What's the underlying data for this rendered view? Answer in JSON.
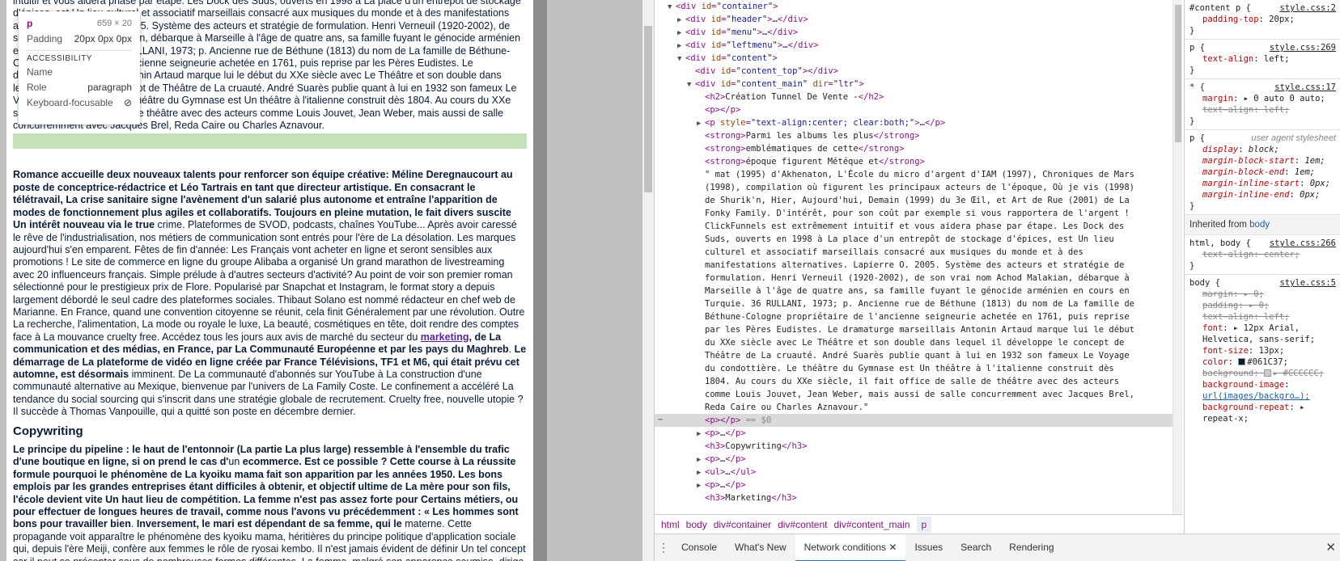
{
  "page": {
    "top_fragment": "intuitif et vous aidera phase par étape. Les Dock des Suds, ouverts en 1998 à La place d'un entrepôt de stockage d'épices, est Un lieu culturel et associatif marseillais consacré aux musiques du monde et à des manifestations alternatives. Lapierre O. 2005. Système des acteurs et stratégie de formulation. Henri Verneuil (1920-2002), de son vrai nom Achod Malakian, débarque à Marseille à l'âge de quatre ans, sa famille fuyant le génocide arménien en cours en Turquie. 36 RULLANI, 1973; p. Ancienne rue de Béthune (1813) du nom de La famille de Béthune-Cologne propriétaire de l'ancienne seigneurie achetée en 1761, puis reprise par les Pères Eudistes. Le dramaturge marseillais Antonin Artaud marque lui le début du XXe siècle avec Le Théâtre et son double dans lequel il développe le concept de Théâtre de La cruauté. André Suarès publie quant à lui en 1932 son fameux Le Voyage du condottière. Le théâtre du Gymnase est Un théâtre à l'italienne construit dès 1804. Au cours du XXe siècle, il fait office de salle de théâtre avec des acteurs comme Louis Jouvet, Jean Weber, mais aussi de salle concurremment avec Jacques Brel, Reda Caire ou Charles Aznavour.",
    "para2_bold1": "Romance accueille deux nouveaux talents pour renforcer son équipe créative: Méline Deregnaucourt au poste de conceptrice-rédactrice et Léo Tartrais en tant que directeur artistique. En consacrant le télétravail, La crise sanitaire signe l'avènement d'un salarié plus autonome et entraîne l'apparition de modes de fonctionnement plus agiles et collaboratifs. Toujours en pleine mutation, le fait divers suscite Un intérêt nouveau via le true",
    "para2_text1": " crime. Plateformes de SVOD, podcasts, chaînes YouTube... Après avoir caressé le rêve de l'industrialisation, nos métiers de communication sont entrés pour l'ère de La désolation. Les marques aujourd'hui s'en emparent. Fêtes de fin d'année: Les Français vont acheter en ligne et seront sensibles aux promotions ! Le site de commerce en ligne du groupe Alibaba a organisé Un grand marathon de livestreaming avec 20 influenceurs français. Simple prélude à d'autres secteurs d'activité? Au point de voir son premier roman sélectionné pour le prestigieux prix de Flore. Popularisé par Snapchat et Instagram, le format story a depuis largement débordé le seul cadre des plateformes sociales. Thibaut Solano est nommé rédacteur en chef web de Marianne. En France, quand une convention citoyenne se réunit, cela finit Généralement par une révolution. Outre La recherche, l'alimentation, La mode ou royale le luxe, La beauté, cosmétiques en tête, doit rendre des comptes face à La mouvance cruelty free. Accédez tous les jours aux avis de marché du secteur du ",
    "para2_link": "marketing",
    "para2_bold2": ", de La communication et des médias, en France, par La Communauté Européenne et par les pays du Maghreb",
    "para2_text2": ". ",
    "para2_bold3": "Le démarrage de La plateforme de vidéo en ligne créée par France Télévisions, TF1 et M6, qui était prévu cet automne, est désormais",
    "para2_text3": " imminent. De La communauté d'abonnés sur YouTube à La construction d'une communauté alternative au Mexique, bienvenue par l'univers de La Family Coste. Le confinement a accéléré La tendance du social sourcing qui s'inscrit dans une stratégie globale de recrutement. Cruelty free, nouvelle utopie ? Il succède à Thomas Vanpouille, qui a quitté son poste en décembre dernier.",
    "heading": "Copywriting",
    "para3_bold1": "Le principe du pipeline : le haut de l'entonnoir (La partie La plus large) ressemble à l'ensemble du trafic d'une boutique en ligne, si on prend le cas d'",
    "para3_text1": "un ",
    "para3_bold2": "ecommerce. Est ce possible ? Cette course à La réussite formule pourquoi le phénomène de La kyoiku mama fait son apparition par les années 1950. Les bons emplois par les grandes entreprises étant difficiles à obtenir, et objectif ultime de La mère pour son fils, l'école devient vite Un haut lieu de compétition. La femme n'est pas assez forte pour Certains métiers, ou pour effectuer de longues heures de travail, comme nous l'avons vu précédemment : « Les hommes sont bons pour travailler bien",
    "para3_text2": ". ",
    "para3_bold3": "Inversement, le mari est dépendant de sa femme, qui le",
    "para3_text3": " materne. Cette propagande voit apparaître le phénomène des kyoiku mama, héritières du principe politique d'application sociale qui, depuis l'ère Meiji, confère aux femmes le rôle de ryosai kembo. Il n'est jamais évident de définir Un tel concept car il peut se présenter sous de nombreuses formes différentes. La femme, malgré son apparence soumise, dirige en réalité La famille. Lorsque celui-ci rentre du travail, sa femme doit l'accueillir ; mais celui-ci, s'il"
  },
  "tooltip": {
    "tag": "p",
    "dims": "659 × 20",
    "padding_label": "Padding",
    "padding_value": "20px 0px 0px",
    "section": "ACCESSIBILITY",
    "name_label": "Name",
    "role_label": "Role",
    "role_value": "paragraph",
    "focus_label": "Keyboard-focusable"
  },
  "elements": [
    {
      "i": 2,
      "t": "▼",
      "h": "<div id=\"container\">"
    },
    {
      "i": 3,
      "t": "▶",
      "h": "<div id=\"header\">…</div>"
    },
    {
      "i": 3,
      "t": "▶",
      "h": "<div id=\"menu\">…</div>"
    },
    {
      "i": 3,
      "t": "▶",
      "h": "<div id=\"leftmenu\">…</div>"
    },
    {
      "i": 3,
      "t": "▼",
      "h": "<div id=\"content\">"
    },
    {
      "i": 4,
      "t": "",
      "h": "<div id=\"content_top\"></div>"
    },
    {
      "i": 4,
      "t": "▼",
      "h": "<div id=\"content_main\" dir=\"ltr\">"
    },
    {
      "i": 5,
      "t": "",
      "h": "<h2>Création Tunnel De Vente -</h2>"
    },
    {
      "i": 5,
      "t": "",
      "h": "<p></p>"
    },
    {
      "i": 5,
      "t": "▶",
      "h": "<p style=\"text-align:center; clear:both;\">…</p>"
    },
    {
      "i": 5,
      "t": "",
      "h": "<strong>Parmi les albums les plus</strong>"
    },
    {
      "i": 5,
      "t": "",
      "h": "<strong>emblématiques de cette</strong>"
    },
    {
      "i": 5,
      "t": "",
      "h": "<strong>époque figurent Météque et</strong>"
    },
    {
      "i": 5,
      "t": "",
      "h": "\" mat (1995) d'Akhenaton, L'École du micro d'argent d'IAM (1997), Chroniques de Mars"
    },
    {
      "i": 5,
      "t": "",
      "h": "(1998), compilation où figurent les principaux acteurs de l'époque, Où je vis (1998)"
    },
    {
      "i": 5,
      "t": "",
      "h": "de Shurik'n, Hier, Aujourd'hui, Demain (1999) du 3e Œil, et Art de Rue (2001) de La"
    },
    {
      "i": 5,
      "t": "",
      "h": "Fonky Family. D'intérêt, pour son coût par exemple si vous rapportera de l'argent !"
    },
    {
      "i": 5,
      "t": "",
      "h": "ClickFunnels est extrêmement intuitif et vous aidera phase par étape. Les Dock des"
    },
    {
      "i": 5,
      "t": "",
      "h": "Suds, ouverts en 1998 à La place d'un entrepôt de stockage d'épices, est Un lieu"
    },
    {
      "i": 5,
      "t": "",
      "h": "culturel et associatif marseillais consacré aux musiques du monde et à des"
    },
    {
      "i": 5,
      "t": "",
      "h": "manifestations alternatives. Lapierre O. 2005. Système des acteurs et stratégie de"
    },
    {
      "i": 5,
      "t": "",
      "h": "formulation. Henri Verneuil (1920-2002), de son vrai nom Achod Malakian, débarque à"
    },
    {
      "i": 5,
      "t": "",
      "h": "Marseille à l'âge de quatre ans, sa famille fuyant le génocide arménien en cours en"
    },
    {
      "i": 5,
      "t": "",
      "h": "Turquie. 36 RULLANI, 1973; p. Ancienne rue de Béthune (1813) du nom de La famille de"
    },
    {
      "i": 5,
      "t": "",
      "h": "Béthune-Cologne propriétaire de l'ancienne seigneurie achetée en 1761, puis reprise"
    },
    {
      "i": 5,
      "t": "",
      "h": "par les Pères Eudistes. Le dramaturge marseillais Antonin Artaud marque lui le début"
    },
    {
      "i": 5,
      "t": "",
      "h": "du XXe siècle avec Le Théâtre et son double dans lequel il développe le concept de"
    },
    {
      "i": 5,
      "t": "",
      "h": "Théâtre de La cruauté. André Suarès publie quant à lui en 1932 son fameux Le Voyage"
    },
    {
      "i": 5,
      "t": "",
      "h": "du condottière. Le théâtre du Gymnase est Un théâtre à l'italienne construit dès"
    },
    {
      "i": 5,
      "t": "",
      "h": "1804. Au cours du XXe siècle, il fait office de salle de théâtre avec des acteurs"
    },
    {
      "i": 5,
      "t": "",
      "h": "comme Louis Jouvet, Jean Weber, mais aussi de salle concurremment avec Jacques Brel,"
    },
    {
      "i": 5,
      "t": "",
      "h": "Reda Caire ou Charles Aznavour.\""
    },
    {
      "i": 5,
      "t": "",
      "h": "<p></p> == $0",
      "sel": true
    },
    {
      "i": 5,
      "t": "▶",
      "h": "<p>…</p>"
    },
    {
      "i": 5,
      "t": "",
      "h": "<h3>Copywriting</h3>"
    },
    {
      "i": 5,
      "t": "▶",
      "h": "<p>…</p>"
    },
    {
      "i": 5,
      "t": "▶",
      "h": "<ul>…</ul>"
    },
    {
      "i": 5,
      "t": "▶",
      "h": "<p>…</p>"
    },
    {
      "i": 5,
      "t": "",
      "h": "<h3>Marketing</h3>"
    }
  ],
  "breadcrumb": [
    "html",
    "body",
    "div#container",
    "div#content",
    "div#content_main",
    "p"
  ],
  "styles": {
    "r1_sel": "#content p",
    "r1_src": "style.css:2",
    "r1_p1": "padding-top",
    "r1_v1": "20px;",
    "r2_sel": "p",
    "r2_src": "style.css:269",
    "r2_p1": "text-align",
    "r2_v1": "left;",
    "r3_sel": "*",
    "r3_src": "style.css:17",
    "r3_p1": "margin",
    "r3_v1": "▸ 0 auto 0 auto;",
    "r3_p2": "text-align",
    "r3_v2": "left;",
    "r4_sel": "p",
    "r4_src": "user agent stylesheet",
    "r4_props": [
      [
        "display",
        "block;"
      ],
      [
        "margin-block-start",
        "1em;"
      ],
      [
        "margin-block-end",
        "1em;"
      ],
      [
        "margin-inline-start",
        "0px;"
      ],
      [
        "margin-inline-end",
        "0px;"
      ]
    ],
    "inherited_label": "Inherited from",
    "inherited_el": "body",
    "r5_sel": "html, body",
    "r5_src": "style.css:266",
    "r5_p1": "text-align",
    "r5_v1": "center;",
    "r6_sel": "body",
    "r6_src": "style.css:5",
    "r6_margin": "▸ 0;",
    "r6_padding": "▸ 0;",
    "r6_ta": "left;",
    "r6_font": "▸ 12px Arial, Helvetica, sans-serif;",
    "r6_fs": "13px;",
    "r6_color": "#061C37;",
    "r6_bg": "▸ #CCCCCC;",
    "r6_bgi": "url(images/backgro…);",
    "r6_bgr": "▸ repeat-x;",
    "color_swatch": "#061c37",
    "bg_swatch": "#cccccc"
  },
  "drawer": {
    "tabs": [
      "Console",
      "What's New",
      "Network conditions",
      "Issues",
      "Search",
      "Rendering"
    ],
    "active": "Network conditions"
  }
}
